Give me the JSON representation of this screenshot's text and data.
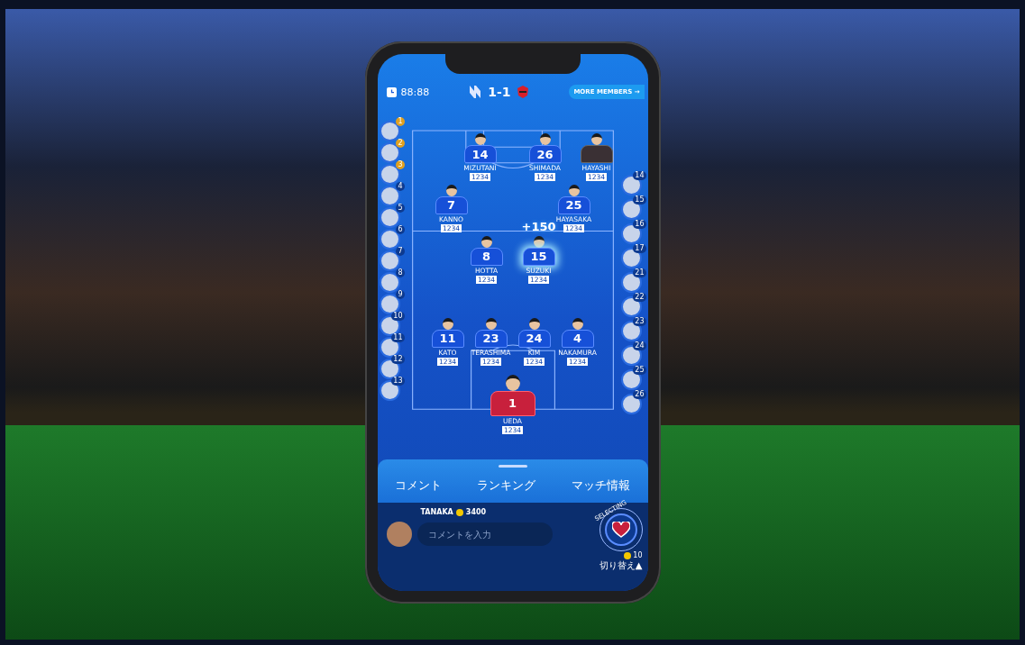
{
  "header": {
    "time": "88:88",
    "score": "1-1",
    "more_button": "MORE MEMBERS →"
  },
  "left_fans": [
    {
      "rank": "1"
    },
    {
      "rank": "2"
    },
    {
      "rank": "3"
    },
    {
      "rank": "4"
    },
    {
      "rank": "5"
    },
    {
      "rank": "6"
    },
    {
      "rank": "7"
    },
    {
      "rank": "8"
    },
    {
      "rank": "9"
    },
    {
      "rank": "10"
    },
    {
      "rank": "11"
    },
    {
      "rank": "12"
    },
    {
      "rank": "13"
    }
  ],
  "right_fans": [
    {
      "rank": "14"
    },
    {
      "rank": "15"
    },
    {
      "rank": "16"
    },
    {
      "rank": "17"
    },
    {
      "rank": "21"
    },
    {
      "rank": "22"
    },
    {
      "rank": "23"
    },
    {
      "rank": "24"
    },
    {
      "rank": "25"
    },
    {
      "rank": "26"
    }
  ],
  "pitch_rows": [
    [
      {
        "kind": "field",
        "number": "14",
        "name": "MIZUTANI",
        "points": "1234"
      },
      {
        "kind": "field",
        "number": "26",
        "name": "SHIMADA",
        "points": "1234"
      },
      {
        "kind": "staff",
        "name": "HAYASHI",
        "points": "1234"
      }
    ],
    [
      {
        "kind": "field",
        "number": "7",
        "name": "KANNO",
        "points": "1234"
      },
      {
        "kind": "field",
        "number": "25",
        "name": "HAYASAKA",
        "points": "1234"
      }
    ],
    [
      {
        "kind": "field",
        "number": "8",
        "name": "HOTTA",
        "points": "1234"
      },
      {
        "kind": "boosted",
        "number": "15",
        "name": "SUZUKI",
        "points": "1234",
        "bonus": "+150"
      }
    ],
    [
      {
        "kind": "field",
        "number": "11",
        "name": "KATO",
        "points": "1234"
      },
      {
        "kind": "field",
        "number": "23",
        "name": "TERASHIMA",
        "points": "1234"
      },
      {
        "kind": "field",
        "number": "24",
        "name": "KIM",
        "points": "1234"
      },
      {
        "kind": "field",
        "number": "4",
        "name": "NAKAMURA",
        "points": "1234"
      }
    ],
    [
      {
        "kind": "keeper",
        "number": "1",
        "name": "UEDA",
        "points": "1234"
      }
    ]
  ],
  "tabs": [
    {
      "label": "コメント"
    },
    {
      "label": "ランキング"
    },
    {
      "label": "マッチ情報"
    }
  ],
  "user": {
    "name": "TANAKA",
    "coins": "3400"
  },
  "comment_field": {
    "placeholder": "コメントを入力"
  },
  "cheer": {
    "ring_label": "SELECTING",
    "cost": "10",
    "switch_label": "切り替え▲"
  }
}
